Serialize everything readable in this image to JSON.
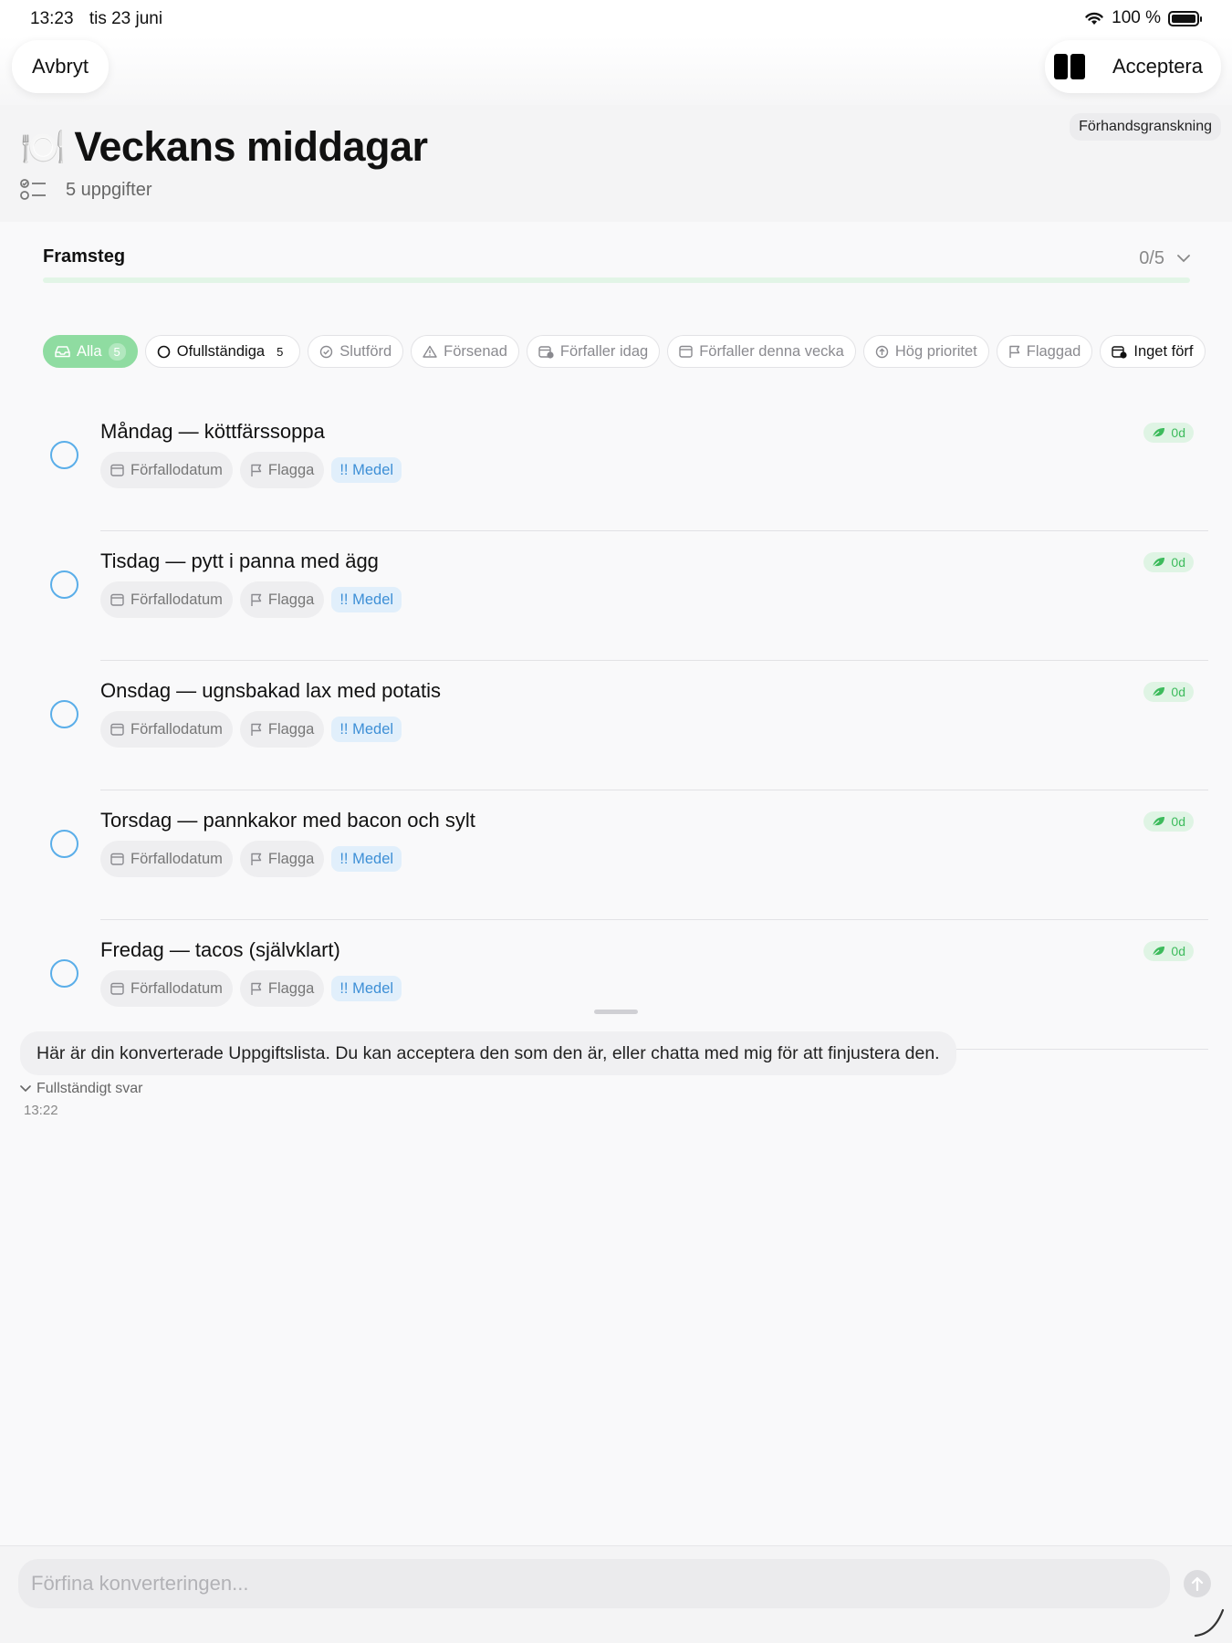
{
  "status_bar": {
    "time": "13:23",
    "date": "tis 23 juni",
    "battery": "100 %"
  },
  "toolbar": {
    "cancel_label": "Avbryt",
    "accept_label": "Acceptera",
    "split_icon": "split-view-icon"
  },
  "header": {
    "emoji": "🍽️",
    "title": "Veckans middagar",
    "count_label": "5 uppgifter",
    "preview_label": "Förhandsgranskning"
  },
  "progress": {
    "label": "Framsteg",
    "value_label": "0/5",
    "fraction": 0
  },
  "filters": [
    {
      "label": "Alla",
      "count": "5",
      "icon": "tray-icon",
      "active": true
    },
    {
      "label": "Ofullständiga",
      "count": "5",
      "icon": "circle-icon",
      "dark": true
    },
    {
      "label": "Slutförd",
      "icon": "check-circle-icon"
    },
    {
      "label": "Försenad",
      "icon": "warning-icon"
    },
    {
      "label": "Förfaller idag",
      "icon": "calendar-clock-icon"
    },
    {
      "label": "Förfaller denna vecka",
      "icon": "calendar-icon"
    },
    {
      "label": "Hög prioritet",
      "icon": "arrow-up-circle-icon"
    },
    {
      "label": "Flaggad",
      "icon": "flag-icon"
    },
    {
      "label": "Inget förf",
      "icon": "calendar-clock-icon",
      "dark": true
    }
  ],
  "tasks": [
    {
      "title": "Måndag — köttfärssoppa",
      "due_label": "Förfallodatum",
      "flag_label": "Flagga",
      "priority_label": "!! Medel",
      "badge": "0d"
    },
    {
      "title": "Tisdag — pytt i panna med ägg",
      "due_label": "Förfallodatum",
      "flag_label": "Flagga",
      "priority_label": "!! Medel",
      "badge": "0d"
    },
    {
      "title": "Onsdag — ugnsbakad lax med potatis",
      "due_label": "Förfallodatum",
      "flag_label": "Flagga",
      "priority_label": "!! Medel",
      "badge": "0d"
    },
    {
      "title": "Torsdag — pannkakor med bacon och sylt",
      "due_label": "Förfallodatum",
      "flag_label": "Flagga",
      "priority_label": "!! Medel",
      "badge": "0d"
    },
    {
      "title": "Fredag — tacos (självklart)",
      "due_label": "Förfallodatum",
      "flag_label": "Flagga",
      "priority_label": "!! Medel",
      "badge": "0d"
    }
  ],
  "message": {
    "text": "Här är din konverterade Uppgiftslista. Du kan acceptera den som den är, eller chatta med mig för att finjustera den.",
    "toggle_label": "Fullständigt svar",
    "time": "13:22"
  },
  "composer": {
    "placeholder": "Förfina konverteringen..."
  },
  "colors": {
    "accent_green": "#34c759",
    "checkbox_blue": "#5aaee9",
    "priority_blue": "#3d8fd6"
  }
}
